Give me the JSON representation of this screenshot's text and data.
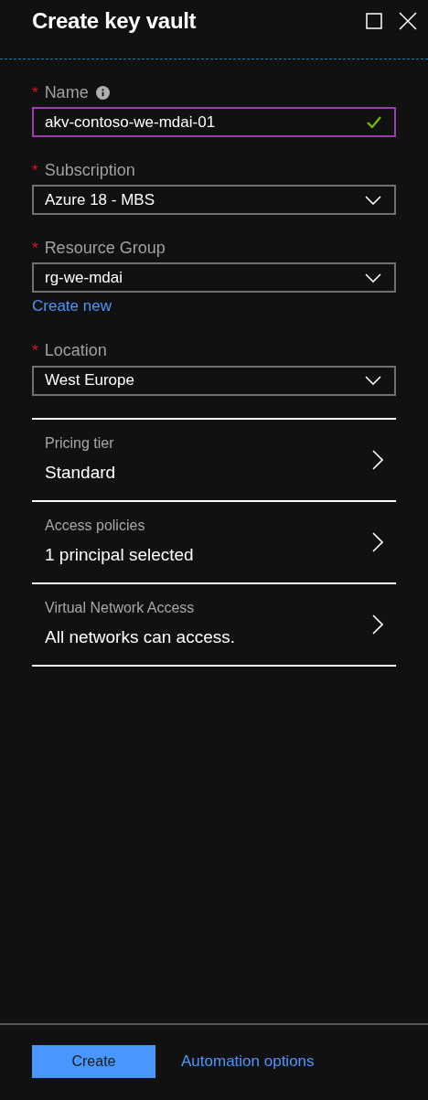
{
  "window": {
    "title": "Create key vault"
  },
  "fields": [
    {
      "kind": "text",
      "label": "Name",
      "marker": "*",
      "info": true,
      "value": "akv-contoso-we-mdai-01",
      "focused": true,
      "valid": true
    },
    {
      "kind": "dropdown",
      "label": "Subscription",
      "marker": "*",
      "value": "Azure 18 - MBS"
    },
    {
      "kind": "dropdown",
      "label": "Resource Group",
      "marker": "*",
      "value": "rg-we-mdai",
      "link": "Create new"
    },
    {
      "kind": "dropdown",
      "label": "Location",
      "marker": "*",
      "value": "West Europe"
    }
  ],
  "settings": [
    {
      "label": "Pricing tier",
      "value": "Standard"
    },
    {
      "label": "Access policies",
      "value": "1 principal selected"
    },
    {
      "label": "Virtual Network Access",
      "value": "All networks can access."
    }
  ],
  "footer": {
    "primary_button": "Create",
    "link": "Automation options"
  }
}
